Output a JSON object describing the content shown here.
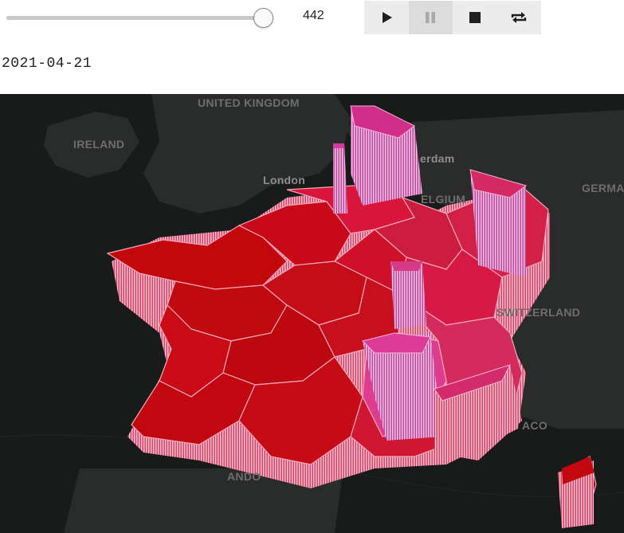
{
  "player": {
    "slider": {
      "value": 442,
      "min": 0,
      "max": 456
    },
    "frame_value": "442",
    "buttons": [
      {
        "name": "play-button",
        "icon": "play-icon"
      },
      {
        "name": "pause-button",
        "icon": "pause-icon"
      },
      {
        "name": "stop-button",
        "icon": "stop-icon"
      },
      {
        "name": "loop-button",
        "icon": "loop-icon"
      }
    ],
    "date": "2021-04-21"
  },
  "map": {
    "background": "#191a1a",
    "labels": {
      "united_kingdom": "UNITED KINGDOM",
      "ireland": "IRELAND",
      "london": "London",
      "amsterdam": "erdam",
      "belgium": "ELGIUM",
      "germany": "GERMA",
      "switzerland": "SWITZERLAND",
      "monaco": "ACO",
      "andorra": "ANDO"
    },
    "colors": {
      "low": "#c0070e",
      "mid": "#d8153a",
      "high": "#e0358f",
      "wall": "#f2b6c8"
    }
  }
}
